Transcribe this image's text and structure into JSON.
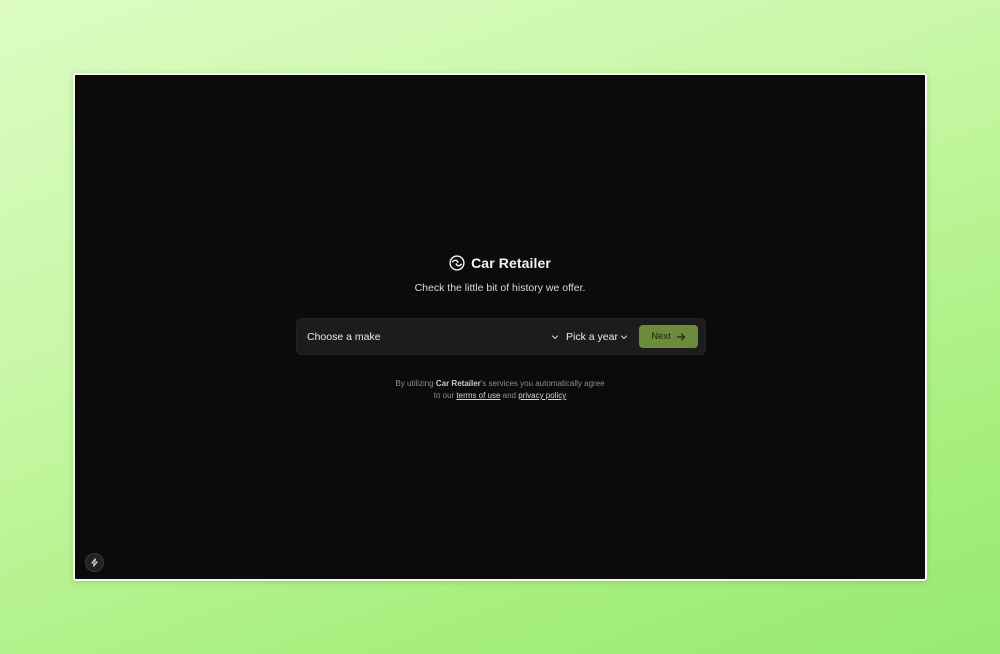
{
  "brand": {
    "title": "Car Retailer",
    "icon": "swirl-logo-icon"
  },
  "tagline": "Check the little bit of history we offer.",
  "form": {
    "make_label": "Choose a make",
    "year_label": "Pick a year",
    "next_label": "Next",
    "next_icon": "arrow-right-icon",
    "accent_color": "#6d8c3b"
  },
  "legal": {
    "prefix": "By utilizing ",
    "brand": "Car Retailer",
    "middle": "'s services you automatically agree",
    "line2_prefix": "to our ",
    "terms_label": "terms of use",
    "and": " and ",
    "privacy_label": "privacy policy"
  },
  "badge_icon": "bolt-icon"
}
